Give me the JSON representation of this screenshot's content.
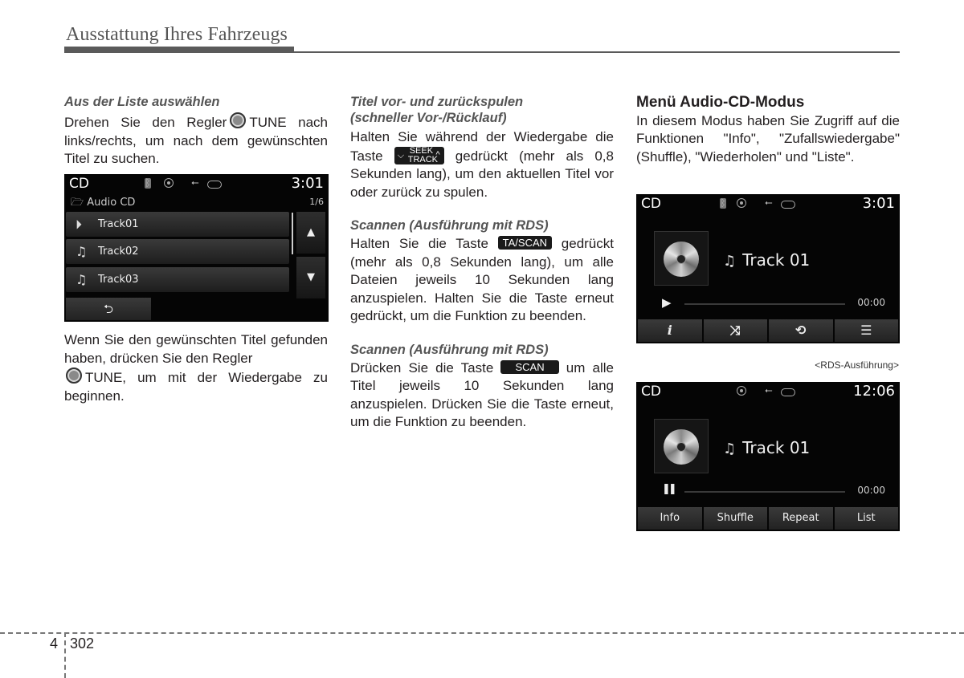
{
  "header": {
    "title": "Ausstattung Ihres Fahrzeugs"
  },
  "col1": {
    "subheading": "Aus der Liste auswählen",
    "p1_before": "Drehen Sie den Regler",
    "p1_after": "TUNE nach links/rechts, um nach dem gewünschten Titel zu suchen.",
    "p2_before": "Wenn Sie den gewünschten Titel gefunden haben, drücken Sie den Regler",
    "p2_after": "TUNE, um mit der Wiedergabe zu beginnen.",
    "knob_icon": "tune-knob-icon"
  },
  "list_screen": {
    "mode": "CD",
    "clock": "3:01",
    "status_icons": [
      "bluetooth-icon",
      "disc-icon",
      "usb-icon",
      "aux-icon"
    ],
    "folder": "Audio CD",
    "page": "1/6",
    "rows": [
      {
        "icon": "play-circle-icon",
        "label": "Track01"
      },
      {
        "icon": "music-note-icon",
        "label": "Track02"
      },
      {
        "icon": "music-note-icon",
        "label": "Track03"
      }
    ],
    "up_glyph": "▲",
    "down_glyph": "▼",
    "back_glyph": "⮌"
  },
  "col2": {
    "section1": {
      "subheading1": "Titel vor- und zurückspulen",
      "subheading2": "(schneller Vor-/Rücklauf)",
      "before": "Halten Sie während der Wiedergabe die Taste",
      "after": "gedrückt (mehr als 0,8 Sekunden lang), um den aktuellen Titel vor oder zurück zu spulen.",
      "key_line1": "SEEK",
      "key_line2": "TRACK"
    },
    "section2": {
      "subheading": "Scannen (Ausführung mit RDS)",
      "before": "Halten Sie die Taste",
      "key": "TA/SCAN",
      "after": "gedrückt (mehr als 0,8 Sekunden lang), um alle Dateien jeweils 10 Sekunden lang anzuspielen. Halten Sie die Taste erneut gedrückt, um die Funktion zu beenden."
    },
    "section3": {
      "subheading": "Scannen (Ausführung mit RDS)",
      "before": "Drücken Sie die Taste",
      "key": "SCAN",
      "after": "um alle Titel jeweils 10 Sekunden lang anzuspielen. Drücken Sie die Taste erneut, um die Funktion zu beenden."
    }
  },
  "col3": {
    "heading": "Menü Audio-CD-Modus",
    "body": "In diesem Modus haben Sie Zugriff auf die Funktionen \"Info\", \"Zufallswiedergabe\" (Shuffle), \"Wiederholen\" und \"Liste\"."
  },
  "player_screen_1": {
    "mode": "CD",
    "clock": "3:01",
    "status_icons": [
      "bluetooth-icon",
      "disc-icon",
      "usb-icon",
      "aux-icon"
    ],
    "track": "Track 01",
    "state_glyph": "▶",
    "time": "00:00",
    "menu": [
      {
        "icon": "info-icon",
        "glyph": "i"
      },
      {
        "icon": "shuffle-icon",
        "glyph": "⤨"
      },
      {
        "icon": "repeat-icon",
        "glyph": "⟲"
      },
      {
        "icon": "list-icon",
        "glyph": "☰"
      }
    ]
  },
  "caption": "<RDS-Ausführung>",
  "player_screen_2": {
    "mode": "CD",
    "clock": "12:06",
    "status_icons": [
      "disc-icon",
      "usb-icon",
      "aux-icon"
    ],
    "track": "Track 01",
    "state_glyph": "❚❚",
    "time": "00:00",
    "menu": [
      {
        "label": "Info"
      },
      {
        "label": "Shuffle"
      },
      {
        "label": "Repeat"
      },
      {
        "label": "List"
      }
    ]
  },
  "footer": {
    "chapter": "4",
    "page": "302"
  }
}
